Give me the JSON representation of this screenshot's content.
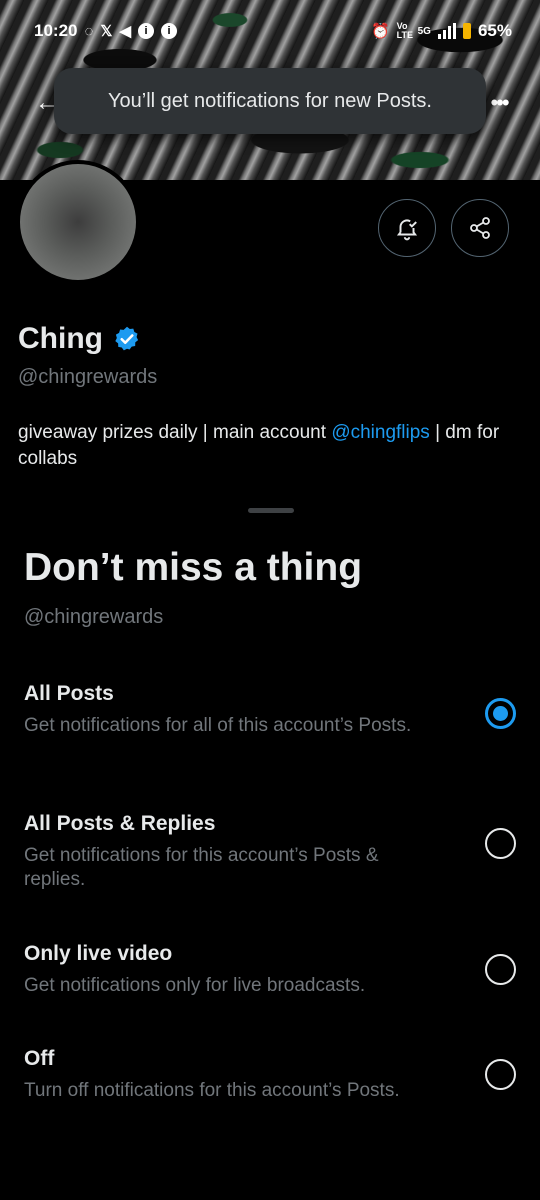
{
  "status_bar": {
    "time": "10:20",
    "left_icons": [
      "whatsapp-icon",
      "x-icon",
      "telegram-icon",
      "info-icon",
      "info-icon"
    ],
    "right_icons": [
      "alarm-icon",
      "volte-icon",
      "5g-icon",
      "signal-icon"
    ],
    "battery": "65%",
    "battery_color": "#f5b400",
    "volte_text": "Vo LTE",
    "network_text": "5G"
  },
  "toast": {
    "message": "You’ll get notifications for new Posts."
  },
  "profile": {
    "name": "Ching",
    "handle": "@chingrewards",
    "bio_prefix": "giveaway prizes daily | main account ",
    "bio_mention": "@chingflips",
    "bio_suffix": " | dm for collabs",
    "verified": true
  },
  "sheet": {
    "title": "Don’t miss a thing",
    "handle": "@chingrewards",
    "options": [
      {
        "title": "All Posts",
        "description": "Get notifications for all of this account’s Posts.",
        "selected": true
      },
      {
        "title": "All Posts & Replies",
        "description": "Get notifications for this account’s Posts & replies.",
        "selected": false
      },
      {
        "title": "Only live video",
        "description": "Get notifications only for live broadcasts.",
        "selected": false
      },
      {
        "title": "Off",
        "description": "Turn off notifications for this account’s Posts.",
        "selected": false
      }
    ]
  },
  "colors": {
    "accent": "#1d9bf0",
    "background": "#000000",
    "secondary_text": "#71767b",
    "primary_text": "#e7e9ea"
  }
}
